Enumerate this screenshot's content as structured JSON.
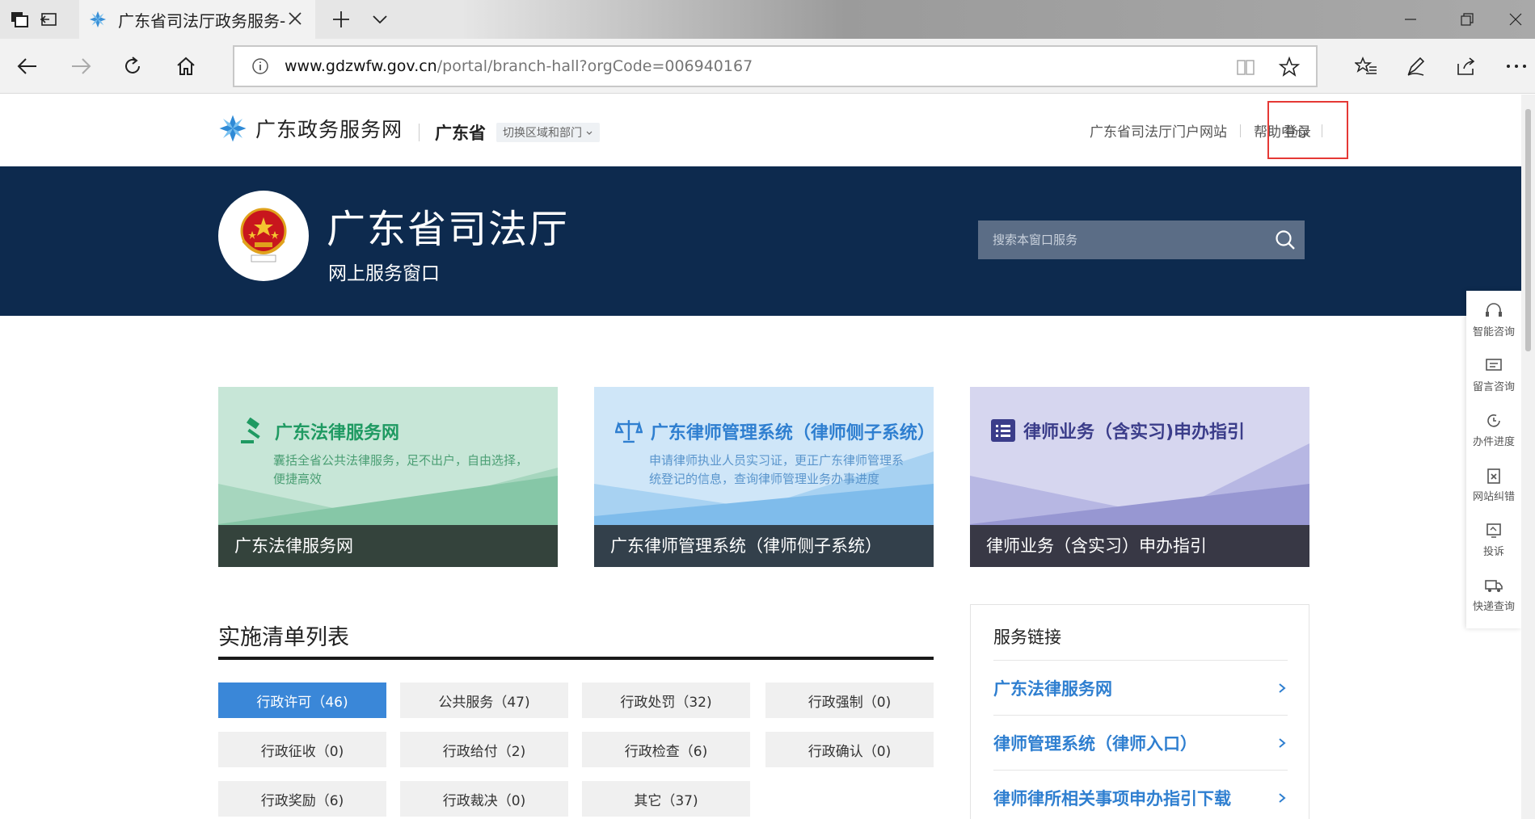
{
  "browser": {
    "tab_title": "广东省司法厅政务服务-",
    "url_host": "www.gdzwfw.gov.cn",
    "url_path": "/portal/branch-hall?orgCode=006940167"
  },
  "header": {
    "site_name": "广东政务服务网",
    "region": "广东省",
    "switch_label": "切换区域和部门",
    "links": [
      "广东省司法厅门户网站",
      "帮助中心"
    ],
    "login": "登录"
  },
  "banner": {
    "dept_name": "广东省司法厅",
    "subtitle": "网上服务窗口",
    "search_placeholder": "搜索本窗口服务"
  },
  "cards": [
    {
      "title": "广东法律服务网",
      "desc": "囊括全省公共法律服务，足不出户，自由选择，便捷高效",
      "footer": "广东法律服务网",
      "accent": "#1f9a62",
      "icon": "gavel-icon"
    },
    {
      "title": "广东律师管理系统（律师侧子系统）",
      "desc": "申请律师执业人员实习证，更正广东律师管理系统登记的信息，查询律师管理业务办事进度",
      "footer": "广东律师管理系统（律师侧子系统）",
      "accent": "#2f7fd0",
      "icon": "scales-icon"
    },
    {
      "title": "律师业务（含实习)申办指引",
      "desc": "",
      "footer": "律师业务（含实习）申办指引",
      "accent": "#3b3d8a",
      "icon": "list-icon"
    }
  ],
  "section": {
    "title": "实施清单列表",
    "filters": [
      "行政许可（46)",
      "公共服务（47)",
      "行政处罚（32)",
      "行政强制（0)",
      "行政征收（0)",
      "行政给付（2)",
      "行政检查（6)",
      "行政确认（0)",
      "行政奖励（6)",
      "行政裁决（0)",
      "其它（37)"
    ],
    "active_filter": 0
  },
  "service_links": {
    "title": "服务链接",
    "items": [
      "广东法律服务网",
      "律师管理系统（律师入口）",
      "律师律所相关事项申办指引下载"
    ]
  },
  "floatbar": [
    "智能咨询",
    "留言咨询",
    "办件进度",
    "网站纠错",
    "投诉",
    "快递查询"
  ]
}
